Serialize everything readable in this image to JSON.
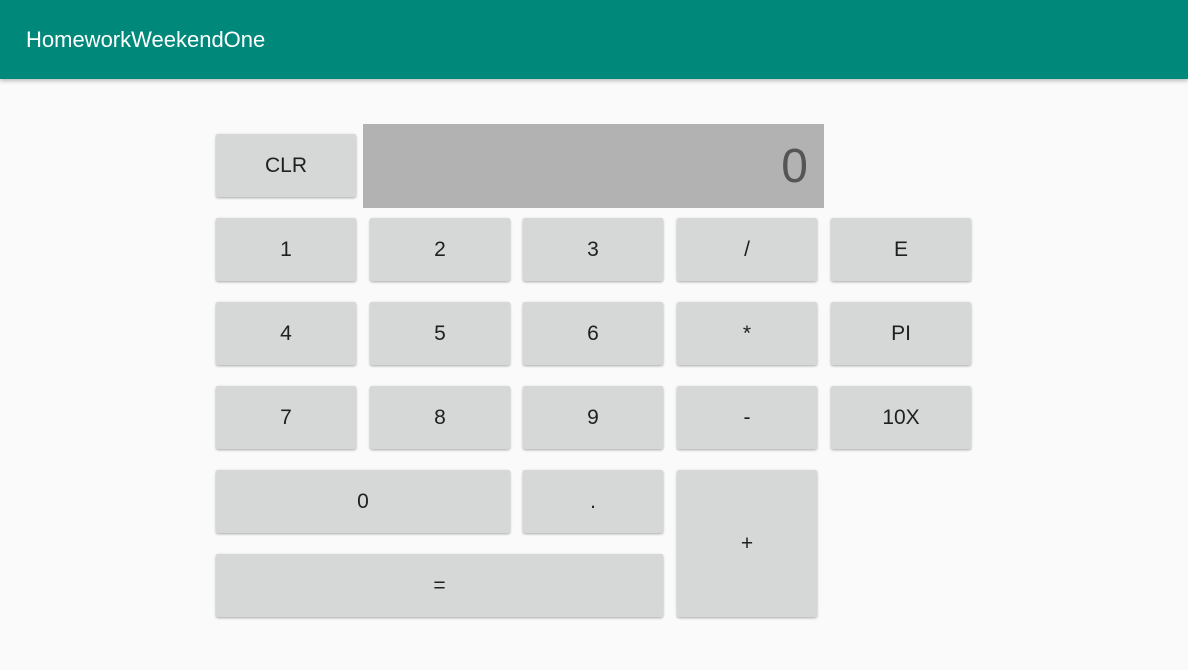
{
  "app": {
    "title": "HomeworkWeekendOne"
  },
  "colors": {
    "app_bar": "#00897b",
    "button": "#d6d7d7",
    "display": "#b2b2b2"
  },
  "display": {
    "value": "0"
  },
  "buttons": {
    "clr": "CLR",
    "one": "1",
    "two": "2",
    "three": "3",
    "divide": "/",
    "e": "E",
    "four": "4",
    "five": "5",
    "six": "6",
    "multiply": "*",
    "pi": "PI",
    "seven": "7",
    "eight": "8",
    "nine": "9",
    "minus": "-",
    "ten_x": "10X",
    "zero": "0",
    "dot": ".",
    "plus": "+",
    "equals": "="
  }
}
